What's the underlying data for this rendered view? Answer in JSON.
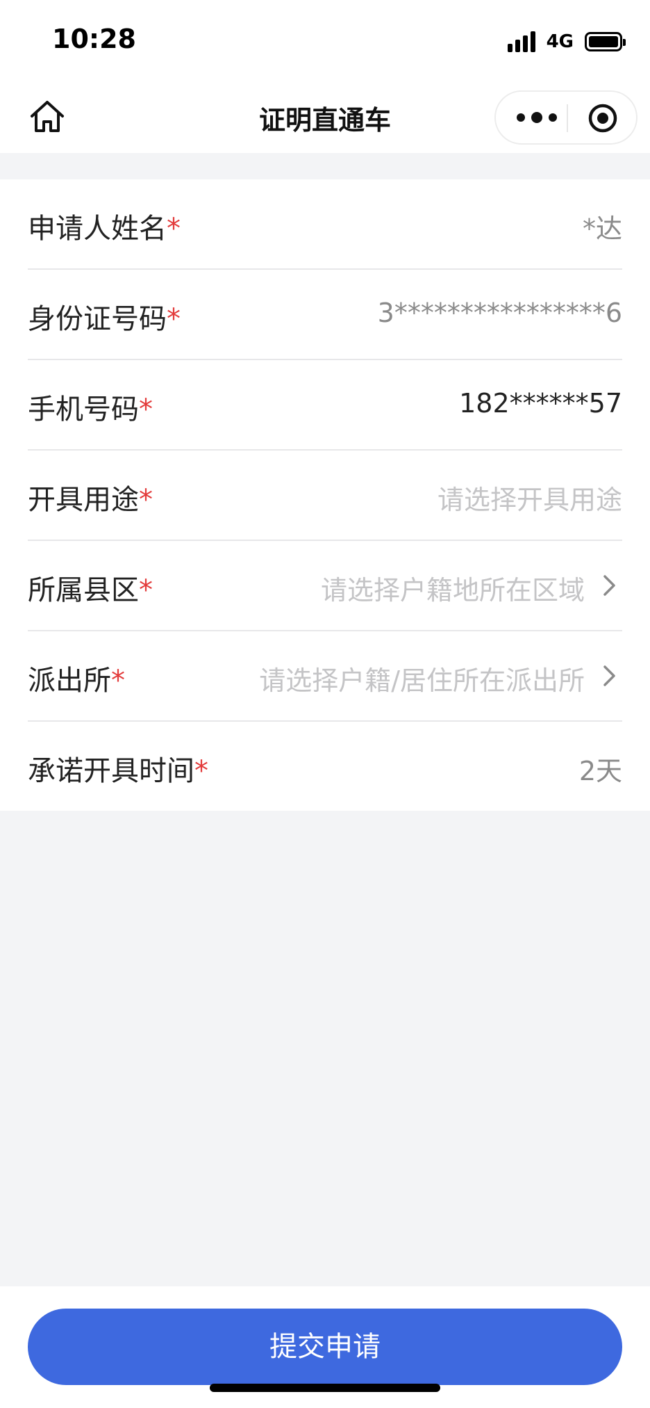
{
  "status_bar": {
    "time": "10:28",
    "network": "4G"
  },
  "nav": {
    "title": "证明直通车",
    "home_icon": "home-icon",
    "more_icon": "more-dots-icon",
    "close_icon": "target-circle-icon"
  },
  "form": {
    "required_mark": "*",
    "rows": [
      {
        "label": "申请人姓名",
        "value": "*达",
        "state": "filled"
      },
      {
        "label": "身份证号码",
        "value": "3****************6",
        "state": "filled"
      },
      {
        "label": "手机号码",
        "value": "182******57",
        "state": "filled"
      },
      {
        "label": "开具用途",
        "value": "请选择开具用途",
        "state": "placeholder"
      },
      {
        "label": "所属县区",
        "value": "请选择户籍地所在区域",
        "state": "placeholder"
      },
      {
        "label": "派出所",
        "value": "请选择户籍/居住所在派出所",
        "state": "placeholder"
      },
      {
        "label": "承诺开具时间",
        "value": "2天",
        "state": "filled"
      }
    ]
  },
  "submit": {
    "label": "提交申请"
  },
  "colors": {
    "accent": "#3e69df",
    "required": "#e33b3b"
  }
}
